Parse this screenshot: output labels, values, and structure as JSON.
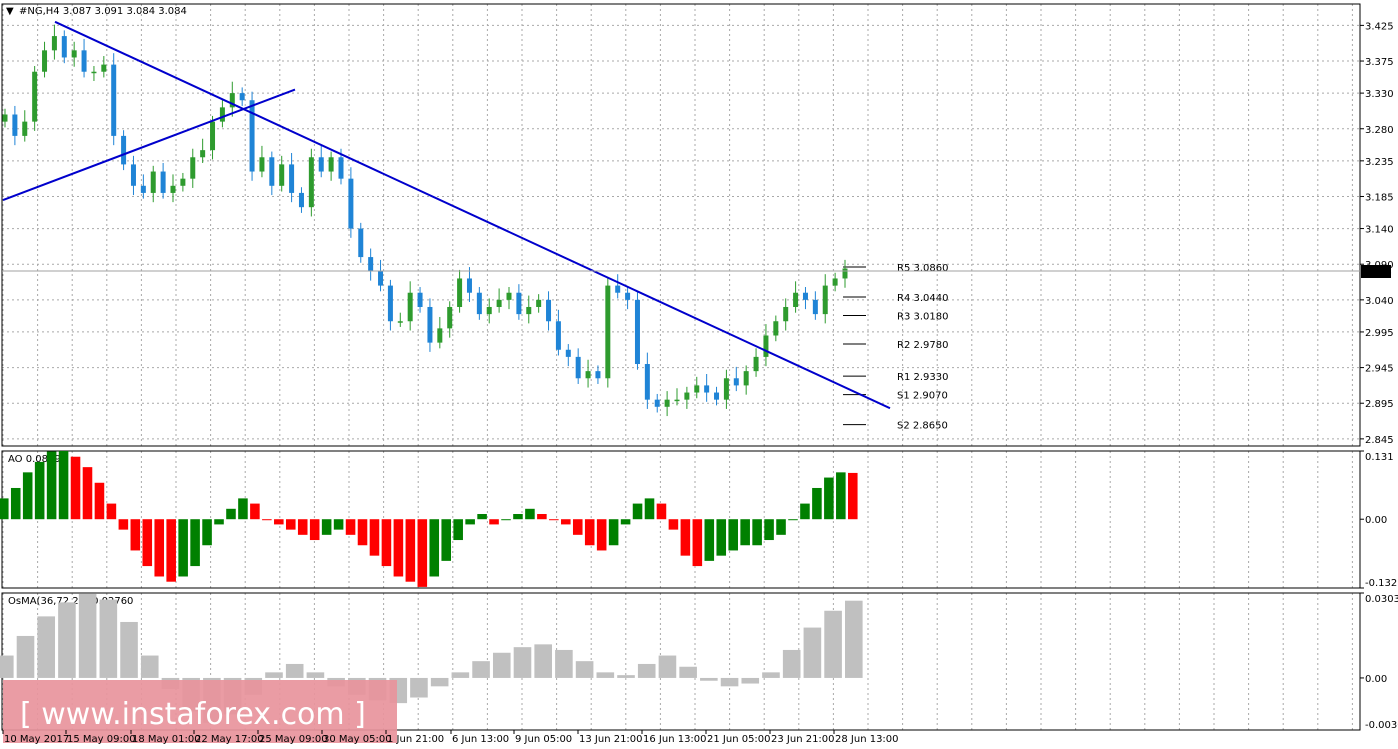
{
  "header": {
    "menu_glyph": "▼",
    "title": "#NG,H4  3.087 3.091 3.084 3.084"
  },
  "colors": {
    "bull": "#2e9b2e",
    "bear": "#1f84d6",
    "trend": "#0000cc",
    "ao_up": "#008000",
    "ao_down": "#ff0000",
    "osma": "#c0c0c0",
    "grid": "#a9a9a9",
    "frame": "#000000",
    "watermark_bg": "#e8949c"
  },
  "price_axis": {
    "ticks": [
      "3.425",
      "3.375",
      "3.330",
      "3.280",
      "3.235",
      "3.185",
      "3.140",
      "3.090",
      "3.040",
      "2.995",
      "2.945",
      "2.895",
      "2.845"
    ],
    "current": "3.084"
  },
  "levels": [
    {
      "name": "R5",
      "label": "R5 3.0860",
      "value": 3.086
    },
    {
      "name": "R4",
      "label": "R4 3.0440",
      "value": 3.044
    },
    {
      "name": "R3",
      "label": "R3 3.0180",
      "value": 3.018
    },
    {
      "name": "R2",
      "label": "R2 2.9780",
      "value": 2.978
    },
    {
      "name": "R1",
      "label": "R1 2.9330",
      "value": 2.933
    },
    {
      "name": "S1",
      "label": "S1 2.9070",
      "value": 2.907
    },
    {
      "name": "S2",
      "label": "S2 2.8650",
      "value": 2.865
    }
  ],
  "time_axis": [
    "10 May 2017",
    "15 May 09:00",
    "18 May 01:00",
    "22 May 17:00",
    "25 May 09:00",
    "30 May 05:00",
    "1 Jun 21:00",
    "6 Jun 13:00",
    "9 Jun 05:00",
    "13 Jun 21:00",
    "16 Jun 13:00",
    "21 Jun 05:00",
    "23 Jun 21:00",
    "28 Jun 13:00"
  ],
  "ao": {
    "title": "AO 0.0889",
    "ticks": [
      "0.131",
      "0.00",
      "-0.1321"
    ]
  },
  "osma": {
    "title": "OsMA(36,72,27) 0.02760",
    "ticks": [
      "0.03035",
      "0.00",
      "-0.00305"
    ]
  },
  "watermark": "[ www.instaforex.com ]",
  "chart_data": {
    "type": "candlestick",
    "symbol": "#NG",
    "timeframe": "H4",
    "ohlc_last": [
      3.087,
      3.091,
      3.084,
      3.084
    ],
    "ylim": [
      2.835,
      3.455
    ],
    "closes": [
      3.3,
      3.27,
      3.29,
      3.36,
      3.39,
      3.41,
      3.38,
      3.39,
      3.36,
      3.36,
      3.37,
      3.27,
      3.23,
      3.2,
      3.19,
      3.22,
      3.19,
      3.2,
      3.21,
      3.24,
      3.25,
      3.29,
      3.31,
      3.33,
      3.32,
      3.22,
      3.24,
      3.2,
      3.23,
      3.19,
      3.17,
      3.24,
      3.22,
      3.24,
      3.21,
      3.14,
      3.1,
      3.08,
      3.06,
      3.01,
      3.01,
      3.05,
      3.03,
      2.98,
      3.0,
      3.03,
      3.07,
      3.05,
      3.02,
      3.03,
      3.04,
      3.05,
      3.02,
      3.03,
      3.04,
      3.01,
      2.97,
      2.96,
      2.93,
      2.94,
      2.93,
      3.06,
      3.05,
      3.04,
      2.95,
      2.9,
      2.89,
      2.9,
      2.9,
      2.91,
      2.92,
      2.91,
      2.9,
      2.93,
      2.92,
      2.94,
      2.96,
      2.99,
      3.01,
      3.03,
      3.05,
      3.04,
      3.02,
      3.06,
      3.07,
      3.084
    ],
    "ao_values": [
      0.04,
      0.06,
      0.09,
      0.11,
      0.13,
      0.131,
      0.12,
      0.1,
      0.07,
      0.03,
      -0.02,
      -0.06,
      -0.09,
      -0.11,
      -0.12,
      -0.11,
      -0.09,
      -0.05,
      -0.01,
      0.02,
      0.04,
      0.03,
      0.0,
      -0.01,
      -0.02,
      -0.03,
      -0.04,
      -0.03,
      -0.02,
      -0.03,
      -0.05,
      -0.07,
      -0.09,
      -0.11,
      -0.12,
      -0.13,
      -0.11,
      -0.08,
      -0.04,
      -0.01,
      0.01,
      -0.01,
      0.0,
      0.01,
      0.02,
      0.01,
      0.0,
      -0.01,
      -0.03,
      -0.05,
      -0.06,
      -0.05,
      -0.01,
      0.03,
      0.04,
      0.03,
      -0.02,
      -0.07,
      -0.09,
      -0.08,
      -0.07,
      -0.06,
      -0.05,
      -0.05,
      -0.04,
      -0.03,
      0.0,
      0.03,
      0.06,
      0.08,
      0.09,
      0.0889
    ],
    "osma_values": [
      0.008,
      0.015,
      0.022,
      0.027,
      0.03,
      0.028,
      0.02,
      0.008,
      -0.004,
      -0.012,
      -0.016,
      -0.013,
      -0.006,
      0.002,
      0.005,
      0.002,
      -0.003,
      -0.006,
      -0.008,
      -0.009,
      -0.007,
      -0.003,
      0.002,
      0.006,
      0.009,
      0.011,
      0.012,
      0.01,
      0.006,
      0.002,
      0.001,
      0.005,
      0.008,
      0.004,
      -0.001,
      -0.003,
      -0.002,
      0.002,
      0.01,
      0.018,
      0.024,
      0.0276
    ],
    "trendlines": [
      {
        "name": "support",
        "from": [
          "start",
          3.18
        ],
        "to": [
          "25 May",
          3.335
        ]
      },
      {
        "name": "resistance",
        "from": [
          "12 May",
          3.43
        ],
        "to": [
          "29 Jun",
          2.89
        ]
      }
    ],
    "legend": "none",
    "grid": true
  }
}
